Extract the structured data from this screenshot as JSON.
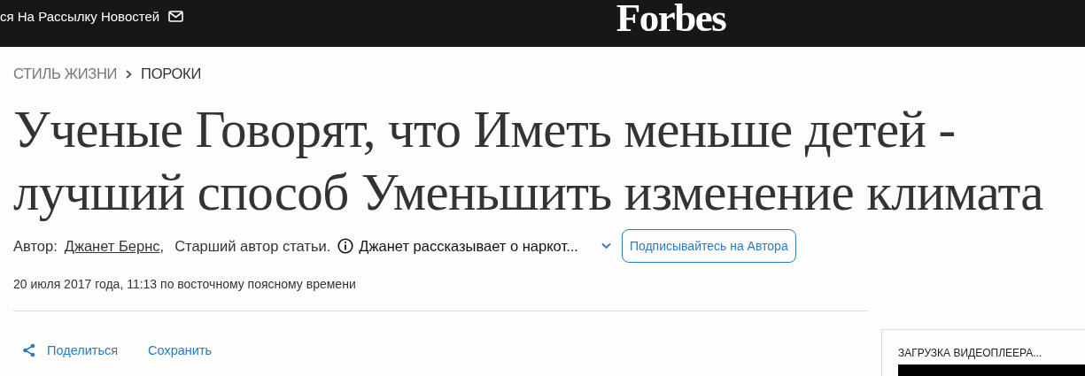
{
  "header": {
    "newsletter": "ся На Рассылку Новостей",
    "logo": "Forbes"
  },
  "breadcrumbs": [
    {
      "label": "СТИЛЬ ЖИЗНИ"
    },
    {
      "label": "ПОРОКИ"
    }
  ],
  "title": "Ученые Говорят, что Иметь меньше детей - лучший способ Уменьшить изменение климата",
  "byline": {
    "prefix": "Автор:",
    "author": "Джанет Бернс",
    "comma": ",",
    "role": "Старший автор статьи.",
    "bio": "Джанет рассказывает о наркот...",
    "follow": "Подписывайтесь на Автора"
  },
  "date": "20 июля 2017 года, 11:13 по восточному поясному времени",
  "actions": [
    {
      "kind": "share",
      "label": "Поделиться"
    },
    {
      "kind": "save",
      "label": "Сохранить"
    }
  ],
  "video": {
    "loading": "ЗАГРУЗКА ВИДЕОПЛЕЕРА..."
  }
}
